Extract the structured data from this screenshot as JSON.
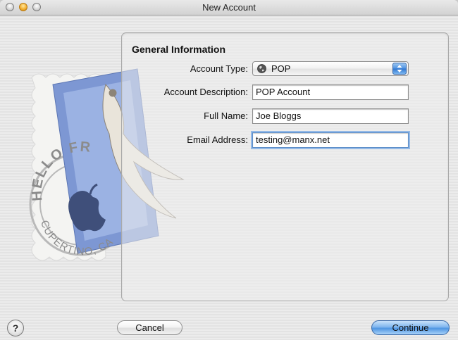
{
  "window": {
    "title": "New Account"
  },
  "section": {
    "title": "General Information"
  },
  "form": {
    "account_type": {
      "label": "Account Type:",
      "value": "POP"
    },
    "account_description": {
      "label": "Account Description:",
      "value": "POP Account"
    },
    "full_name": {
      "label": "Full Name:",
      "value": "Joe Bloggs"
    },
    "email_address": {
      "label": "Email Address:",
      "value": "testing@manx.net"
    }
  },
  "stamp": {
    "top_text": "HELLO FR",
    "bottom_text": "CUPERTINO, CA"
  },
  "buttons": {
    "help": "?",
    "cancel": "Cancel",
    "continue": "Continue"
  },
  "colors": {
    "accent": "#4f95e2",
    "focus_ring": "#94b9e6",
    "stamp_blue": "#6f8fcc"
  }
}
